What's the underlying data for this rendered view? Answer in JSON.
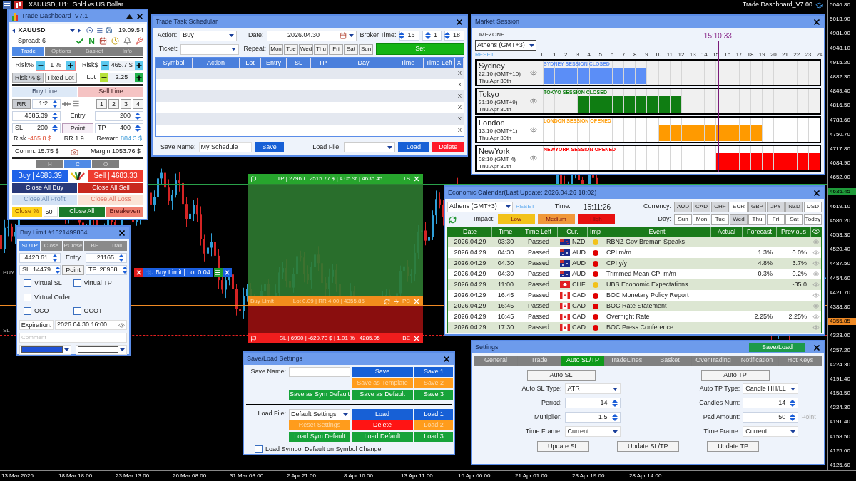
{
  "chart": {
    "symbol_title": "XAUUSD, H1:  Gold vs US Dollar",
    "ea_name": "Trade Dashboard_V7.00",
    "prices": [
      {
        "text": "5046.80"
      },
      {
        "text": "5013.90"
      },
      {
        "text": "4981.00"
      },
      {
        "text": "4948.10"
      },
      {
        "text": "4915.20"
      },
      {
        "text": "4882.30"
      },
      {
        "text": "4849.40"
      },
      {
        "text": "4816.50"
      },
      {
        "text": "4783.60"
      },
      {
        "text": "4750.70"
      },
      {
        "text": "4717.80"
      },
      {
        "text": "4684.90"
      },
      {
        "text": "4652.00"
      },
      {
        "text": "4635.45",
        "color": "#1f9b3a"
      },
      {
        "text": "4619.10"
      },
      {
        "text": "4586.20"
      },
      {
        "text": "4553.30"
      },
      {
        "text": "4520.40"
      },
      {
        "text": "4487.50"
      },
      {
        "text": "4454.60"
      },
      {
        "text": "4421.70"
      },
      {
        "text": "4388.80"
      },
      {
        "text": "4355.85",
        "color": "#f08a24"
      },
      {
        "text": "4323.00"
      },
      {
        "text": "4257.20"
      },
      {
        "text": "4224.30"
      },
      {
        "text": "4191.40"
      },
      {
        "text": "4158.50"
      },
      {
        "text": "4224.30"
      },
      {
        "text": "4191.40"
      },
      {
        "text": "4158.50"
      },
      {
        "text": "4125.60"
      },
      {
        "text": "4125.60"
      }
    ],
    "times": [
      "13 Mar 2026",
      "18 Mar 18:00",
      "23 Mar 13:00",
      "26 Mar 08:00",
      "31 Mar 03:00",
      "2 Apr 21:00",
      "8 Apr 16:00",
      "13 Apr 11:00",
      "16 Apr 06:00",
      "21 Apr 01:00",
      "23 Apr 19:00",
      "28 Apr 14:00"
    ],
    "line_labels": [
      "BUY",
      "SL"
    ]
  },
  "trade_zone": {
    "tp_bar": "TP | 27960 | 2515.77 $ | 4.05 % | 4635.45",
    "tp_tag": "TS",
    "entry_label": "Buy Limit",
    "entry_info": "Lot 0.09 | RR 4.00 | 4355.85",
    "entry_tag": "PC",
    "sl_bar": "SL | 6990 | -629.73 $ | 1.01 % | 4285.95",
    "sl_tag": "BE",
    "order_label": "Buy Limit | Lot 0.04"
  },
  "dashboard": {
    "title": "Trade Dashboard_V7.1",
    "symbol": "XAUUSD",
    "time": "19:09:54",
    "spread": "Spread: 6",
    "news_mark": "N",
    "tabs": [
      {
        "label": "Trade",
        "selected": true
      },
      {
        "label": "Options",
        "selected": false
      },
      {
        "label": "Basket",
        "selected": false
      },
      {
        "label": "Info",
        "selected": false
      }
    ],
    "risk_pct": {
      "label": "Risk%",
      "value": "1 %"
    },
    "risk_usd": {
      "label": "Risk$",
      "value": "465.7 $"
    },
    "modes": [
      {
        "label": "Risk % $",
        "selected": true
      },
      {
        "label": "Fixed Lot",
        "selected": false
      }
    ],
    "lot": {
      "label": "Lot",
      "value": "2.25"
    },
    "line_buttons": [
      {
        "label": "Buy Line",
        "kind": "buy"
      },
      {
        "label": "Sell Line",
        "kind": "sell"
      }
    ],
    "rr": {
      "label": "RR",
      "value": "1:2"
    },
    "presets": [
      "1",
      "2",
      "3",
      "4"
    ],
    "entry_price": "4685.39",
    "entry_label": "Entry",
    "entry_points": "200",
    "sl": {
      "label": "SL",
      "value": "200"
    },
    "point_label": "Point",
    "tp": {
      "label": "TP",
      "value": "400"
    },
    "risk": {
      "label": "Risk",
      "value": "-465.8 $"
    },
    "rr_text": "RR 1.9",
    "reward": {
      "label": "Reward",
      "value": "884.3 $"
    },
    "comm": "Comm. 15.75 $",
    "margin": "Margin 1053.76 $",
    "hco": [
      {
        "label": "H",
        "selected": false
      },
      {
        "label": "C",
        "selected": true
      },
      {
        "label": "O",
        "selected": false
      }
    ],
    "buy": "Buy | 4683.39",
    "sell": "Sell | 4683.33",
    "close_buttons": [
      {
        "label": "Close All Buy",
        "kind": "buy",
        "disabled": false
      },
      {
        "label": "Close All Sell",
        "kind": "sell",
        "disabled": false
      },
      {
        "label": "Close All Profit",
        "kind": "buy",
        "disabled": true
      },
      {
        "label": "Close All Loss",
        "kind": "sell",
        "disabled": true
      }
    ],
    "close_pct": {
      "label": "Close %",
      "value": "50"
    },
    "close_all": "Close All",
    "breakeven": "Breakeven"
  },
  "order_window": {
    "title": "Buy Limit #1621499804",
    "tabs": [
      {
        "label": "SL/TP",
        "selected": true
      },
      {
        "label": "Close",
        "selected": false
      },
      {
        "label": "PClose",
        "selected": false
      },
      {
        "label": "BE",
        "selected": false
      },
      {
        "label": "Trail",
        "selected": false
      }
    ],
    "price": "4420.61",
    "entry_label": "Entry",
    "entry": "21165",
    "sl": {
      "label": "SL",
      "value": "14479"
    },
    "point_label": "Point",
    "tp": {
      "label": "TP",
      "value": "28958"
    },
    "checkboxes": [
      {
        "label": "Virtual SL",
        "checked": false
      },
      {
        "label": "Virtual TP",
        "checked": false
      },
      {
        "label": "Virtual Order",
        "checked": false
      },
      {
        "label": "OCO",
        "checked": false
      },
      {
        "label": "OCOT",
        "checked": false
      }
    ],
    "expiration": {
      "label": "Expiration:",
      "value": "2026.04.30 16:00"
    },
    "comment_placeholder": "Comment",
    "swatches": [
      {
        "color": "#1f52d8"
      },
      {
        "color": "#ffffff"
      }
    ]
  },
  "scheduler": {
    "title": "Trade Task Schedular",
    "action": {
      "label": "Action:",
      "value": "Buy"
    },
    "date": {
      "label": "Date:",
      "value": "2026.04.30"
    },
    "broker_time": {
      "label": "Broker Time:",
      "values": [
        "16",
        "1",
        "18"
      ]
    },
    "ticket": {
      "label": "Ticket:"
    },
    "repeat": {
      "label": "Repeat:",
      "days": [
        {
          "label": "Mon",
          "selected": false
        },
        {
          "label": "Tue",
          "selected": false
        },
        {
          "label": "Wed",
          "selected": false
        },
        {
          "label": "Thu",
          "selected": false
        },
        {
          "label": "Fri",
          "selected": false
        },
        {
          "label": "Sat",
          "selected": false
        },
        {
          "label": "Sun",
          "selected": false
        }
      ]
    },
    "set": "Set",
    "columns": [
      "Symbol",
      "Action",
      "Lot",
      "Entry",
      "SL",
      "TP",
      "Day",
      "Time",
      "Time Left",
      "X"
    ],
    "rows": [
      {
        "delete": "X"
      },
      {
        "delete": "X"
      },
      {
        "delete": "X"
      },
      {
        "delete": "X"
      },
      {
        "delete": "X"
      },
      {
        "delete": "X"
      }
    ],
    "save_name": {
      "label": "Save Name:",
      "value": "My Schedule"
    },
    "save": "Save",
    "load_file": {
      "label": "Load File:"
    },
    "load": "Load",
    "delete": "Delete"
  },
  "market_session": {
    "title": "Market Session",
    "timezone_label": "TIMEZONE",
    "timezone": "Athens (GMT+3)",
    "reset": "RESET",
    "current_time": "15:10:33",
    "hours": [
      "0",
      "1",
      "2",
      "3",
      "4",
      "5",
      "6",
      "7",
      "8",
      "9",
      "10",
      "11",
      "12",
      "13",
      "14",
      "15",
      "16",
      "17",
      "18",
      "19",
      "20",
      "21",
      "22",
      "23",
      "24"
    ],
    "sessions": [
      {
        "name": "Sydney",
        "time": "22:10 (GMT+10)",
        "date": "Thu Apr 30th",
        "status": "SYDNEY SESSION CLOSED",
        "open": false,
        "color": "#5b8ef7",
        "hours_on": [
          true,
          true,
          true,
          true,
          true,
          true,
          true,
          true,
          true,
          false,
          false,
          false,
          false,
          false,
          false,
          false,
          false,
          false,
          false,
          false,
          false,
          false,
          false,
          false
        ]
      },
      {
        "name": "Tokyo",
        "time": "21:10 (GMT+9)",
        "date": "Thu Apr 30th",
        "status": "TOKYO SESSION CLOSED",
        "open": false,
        "color": "#0f7d12",
        "hours_on": [
          false,
          false,
          false,
          true,
          true,
          true,
          true,
          true,
          true,
          true,
          true,
          true,
          false,
          false,
          false,
          false,
          false,
          false,
          false,
          false,
          false,
          false,
          false,
          false
        ]
      },
      {
        "name": "London",
        "time": "13:10 (GMT+1)",
        "date": "Thu Apr 30th",
        "status": "LONDON SESSION OPENED",
        "open": true,
        "color": "#ff9a00",
        "hours_on": [
          false,
          false,
          false,
          false,
          false,
          false,
          false,
          false,
          false,
          false,
          true,
          true,
          true,
          true,
          true,
          true,
          true,
          true,
          true,
          false,
          false,
          false,
          false,
          false
        ]
      },
      {
        "name": "NewYork",
        "time": "08:10 (GMT-4)",
        "date": "Thu Apr 30th",
        "status": "NEWYORK SESSION OPENED",
        "open": true,
        "color": "#ff0000",
        "hours_on": [
          false,
          false,
          false,
          false,
          false,
          false,
          false,
          false,
          false,
          false,
          false,
          false,
          false,
          false,
          false,
          true,
          true,
          true,
          true,
          true,
          true,
          true,
          true,
          true
        ]
      }
    ]
  },
  "calendar": {
    "title": "Economic Calendar(Last Update: 2026.04.26 18:02)",
    "timezone": "Athens (GMT+3)",
    "reset": "RESET",
    "time_label": "Time:",
    "time": "15:11:26",
    "currency_label": "Currency:",
    "currencies": [
      {
        "label": "AUD",
        "selected": true
      },
      {
        "label": "CAD",
        "selected": true
      },
      {
        "label": "CHF",
        "selected": true
      },
      {
        "label": "EUR",
        "selected": false
      },
      {
        "label": "GBP",
        "selected": true
      },
      {
        "label": "JPY",
        "selected": true
      },
      {
        "label": "NZD",
        "selected": true
      },
      {
        "label": "USD",
        "selected": false
      }
    ],
    "impact_label": "Impact:",
    "impacts": [
      {
        "label": "Low",
        "color": "#f2c21a"
      },
      {
        "label": "Medium",
        "color": "#f0983a"
      },
      {
        "label": "High",
        "color": "#e81010"
      }
    ],
    "day_label": "Day:",
    "days": [
      {
        "label": "Sun",
        "selected": false
      },
      {
        "label": "Mon",
        "selected": false
      },
      {
        "label": "Tue",
        "selected": false
      },
      {
        "label": "Wed",
        "selected": true
      },
      {
        "label": "Thu",
        "selected": false
      },
      {
        "label": "Fri",
        "selected": false
      },
      {
        "label": "Sat",
        "selected": false
      },
      {
        "label": "Today",
        "selected": false
      }
    ],
    "columns": [
      "Date",
      "Time",
      "Time Left",
      "Cur.",
      "Imp",
      "Event",
      "Actual",
      "Forecast",
      "Previous"
    ],
    "rows": [
      {
        "date": "2026.04.29",
        "time": "03:30",
        "time_left": "Passed",
        "flag": {
          "kind": "nz"
        },
        "currency": "NZD",
        "impact": {
          "color": "#f2c21a"
        },
        "event": "RBNZ Gov Breman Speaks"
      },
      {
        "date": "2026.04.29",
        "time": "04:30",
        "time_left": "Passed",
        "flag": {
          "kind": "au"
        },
        "currency": "AUD",
        "impact": {
          "color": "#e00000"
        },
        "event": "CPI m/m",
        "forecast": "1.3%",
        "previous": "0.0%"
      },
      {
        "date": "2026.04.29",
        "time": "04:30",
        "time_left": "Passed",
        "flag": {
          "kind": "au"
        },
        "currency": "AUD",
        "impact": {
          "color": "#e00000"
        },
        "event": "CPI y/y",
        "forecast": "4.8%",
        "previous": "3.7%"
      },
      {
        "date": "2026.04.29",
        "time": "04:30",
        "time_left": "Passed",
        "flag": {
          "kind": "au"
        },
        "currency": "AUD",
        "impact": {
          "color": "#e00000"
        },
        "event": "Trimmed Mean CPI m/m",
        "forecast": "0.3%",
        "previous": "0.2%"
      },
      {
        "date": "2026.04.29",
        "time": "11:00",
        "time_left": "Passed",
        "flag": {
          "kind": "ch"
        },
        "currency": "CHF",
        "impact": {
          "color": "#f2c21a"
        },
        "event": "UBS Economic Expectations",
        "previous": "-35.0"
      },
      {
        "date": "2026.04.29",
        "time": "16:45",
        "time_left": "Passed",
        "flag": {
          "kind": "ca"
        },
        "currency": "CAD",
        "impact": {
          "color": "#e00000"
        },
        "event": "BOC Monetary Policy Report"
      },
      {
        "date": "2026.04.29",
        "time": "16:45",
        "time_left": "Passed",
        "flag": {
          "kind": "ca"
        },
        "currency": "CAD",
        "impact": {
          "color": "#e00000"
        },
        "event": "BOC Rate Statement"
      },
      {
        "date": "2026.04.29",
        "time": "16:45",
        "time_left": "Passed",
        "flag": {
          "kind": "ca"
        },
        "currency": "CAD",
        "impact": {
          "color": "#e00000"
        },
        "event": "Overnight Rate",
        "forecast": "2.25%",
        "previous": "2.25%"
      },
      {
        "date": "2026.04.29",
        "time": "17:30",
        "time_left": "Passed",
        "flag": {
          "kind": "ca"
        },
        "currency": "CAD",
        "impact": {
          "color": "#e00000"
        },
        "event": "BOC Press Conference"
      }
    ]
  },
  "settings": {
    "title": "Settings",
    "save_load": "Save/Load",
    "tabs": [
      {
        "label": "General",
        "selected": false
      },
      {
        "label": "Trade",
        "selected": false
      },
      {
        "label": "Auto SL/TP",
        "selected": true
      },
      {
        "label": "TradeLines",
        "selected": false
      },
      {
        "label": "Basket",
        "selected": false
      },
      {
        "label": "OverTrading",
        "selected": false
      },
      {
        "label": "Notification",
        "selected": false
      },
      {
        "label": "Hot Keys",
        "selected": false
      }
    ],
    "auto_sl": "Auto SL",
    "auto_tp": "Auto TP",
    "sl_fields": [
      {
        "label": "Auto SL Type:",
        "value": "ATR",
        "kind": "select"
      },
      {
        "label": "Period:",
        "value": "14",
        "kind": "spin"
      },
      {
        "label": "Multiplier:",
        "value": "1.5",
        "kind": "spin"
      },
      {
        "label": "Time Frame:",
        "value": "Current",
        "kind": "select"
      }
    ],
    "tp_fields": [
      {
        "label": "Auto TP Type:",
        "value": "Candle HH/LL",
        "kind": "select"
      },
      {
        "label": "Candles Num:",
        "value": "14",
        "kind": "spin"
      },
      {
        "label": "Pad Amount:",
        "value": "50",
        "kind": "spin",
        "unit": "Point"
      },
      {
        "label": "Time Frame:",
        "value": "Current",
        "kind": "select"
      }
    ],
    "buttons": [
      "Update SL",
      "Update SL/TP",
      "Update TP"
    ]
  },
  "save_load": {
    "title": "Save/Load Settings",
    "save_label": "Save Name:",
    "save_rows": [
      [
        {
          "label": "Save",
          "color": "#1760d6",
          "disabled": false
        },
        {
          "label": "Save 1",
          "color": "#1760d6",
          "disabled": false
        }
      ],
      [
        {
          "label": "Save as Template",
          "color": "#ff9c1c",
          "disabled": true
        },
        {
          "label": "Save 2",
          "color": "#ff9c1c",
          "disabled": true
        }
      ],
      [
        {
          "label": "Save as Sym Default",
          "color": "#17a33a",
          "disabled": false
        },
        {
          "label": "Save as Default",
          "color": "#17a33a",
          "disabled": false
        },
        {
          "label": "Save 3",
          "color": "#17a33a",
          "disabled": false
        }
      ]
    ],
    "load_label": "Load File:",
    "load_value": "Default Settings",
    "load_rows": [
      [
        {
          "label": "Load",
          "color": "#1760d6",
          "disabled": false
        },
        {
          "label": "Load 1",
          "color": "#1760d6",
          "disabled": false
        }
      ],
      [
        {
          "label": "Reset Settings",
          "color": "#ff9c1c",
          "disabled": true
        },
        {
          "label": "Delete",
          "color": "#ff1414",
          "disabled": false
        },
        {
          "label": "Load 2",
          "color": "#ff9c1c",
          "disabled": true
        }
      ],
      [
        {
          "label": "Load Sym Default",
          "color": "#17a33a",
          "disabled": false
        },
        {
          "label": "Load Default",
          "color": "#17a33a",
          "disabled": false
        },
        {
          "label": "Load 3",
          "color": "#17a33a",
          "disabled": false
        }
      ]
    ],
    "checkbox": {
      "label": "Load Symbol Default on Symbol Change",
      "checked": false
    }
  }
}
